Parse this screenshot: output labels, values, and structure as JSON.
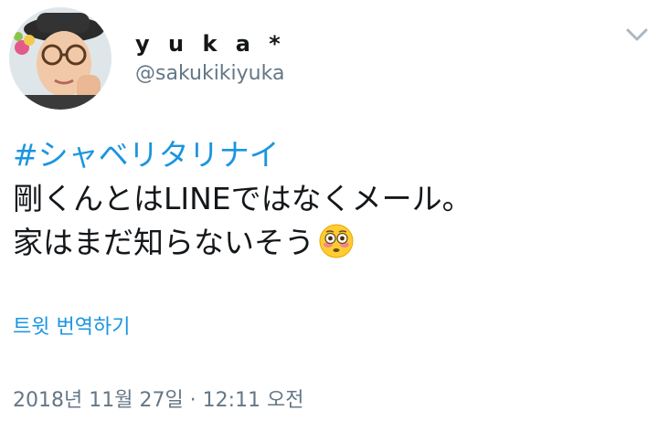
{
  "author": {
    "display_name": "y u k a *",
    "handle": "@sakukikiyuka"
  },
  "tweet": {
    "hashtag": "#シャベリタリナイ",
    "line1": "剛くんとはLINEではなくメール。",
    "line2": "家はまだ知らないそう",
    "emoji": "flushed-face"
  },
  "translate_label": "트윗 번역하기",
  "timestamp": "2018년 11월 27일 · 12:11 오전",
  "colors": {
    "link": "#1b95e0",
    "text": "#14171a",
    "muted": "#657786"
  }
}
